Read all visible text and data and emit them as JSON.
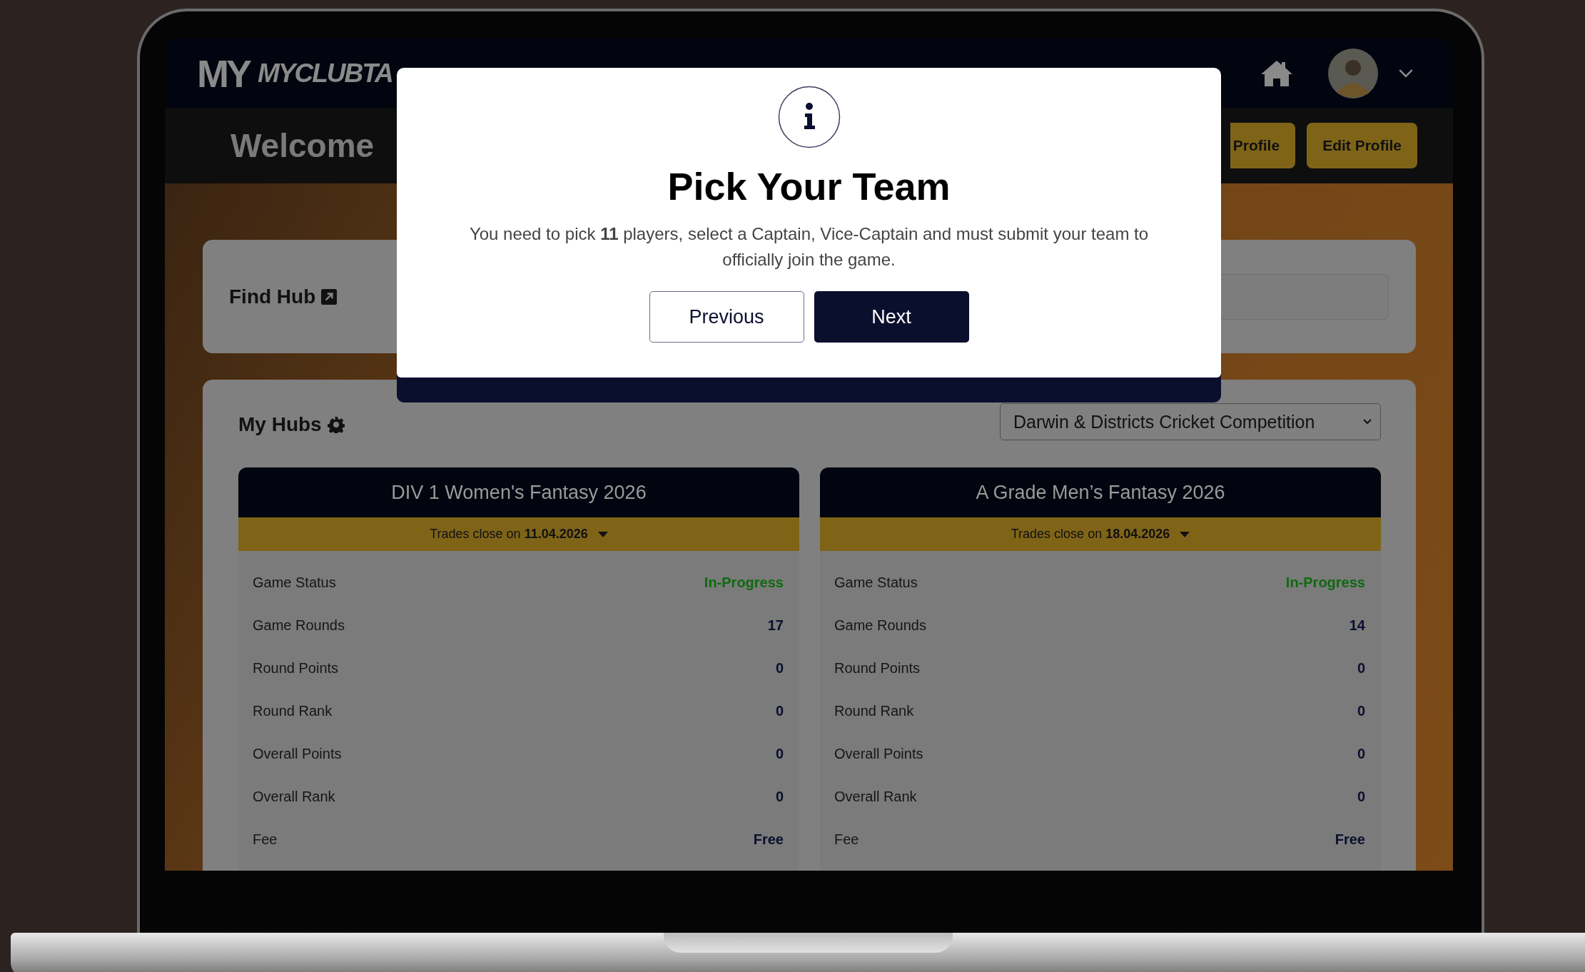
{
  "header": {
    "logo_mark": "MY",
    "logo_text": "MYCLUBTA"
  },
  "welcome": {
    "title": "Welcome",
    "buttons": [
      {
        "label": "Profile"
      },
      {
        "label": "Edit Profile"
      }
    ]
  },
  "find_hub": {
    "title": "Find Hub"
  },
  "my_hubs": {
    "title": "My Hubs",
    "competition_select": {
      "value": "Darwin & Districts Cricket Competition"
    },
    "hubs": [
      {
        "title": "DIV 1 Women's Fantasy 2026",
        "trades_close": "Trades close on **11.04.2026**",
        "stats": [
          {
            "label": "Game Status",
            "value": "In-Progress",
            "kind": "status"
          },
          {
            "label": "Game Rounds",
            "value": "17",
            "kind": "plain"
          },
          {
            "label": "Round Points",
            "value": "0",
            "kind": "plain"
          },
          {
            "label": "Round Rank",
            "value": "0",
            "kind": "plain"
          },
          {
            "label": "Overall Points",
            "value": "0",
            "kind": "plain"
          },
          {
            "label": "Overall Rank",
            "value": "0",
            "kind": "plain"
          },
          {
            "label": "Fee",
            "value": "Free",
            "kind": "plain"
          }
        ]
      },
      {
        "title": "A Grade Men’s Fantasy 2026",
        "trades_close": "Trades close on **18.04.2026**",
        "stats": [
          {
            "label": "Game Status",
            "value": "In-Progress",
            "kind": "status"
          },
          {
            "label": "Game Rounds",
            "value": "14",
            "kind": "plain"
          },
          {
            "label": "Round Points",
            "value": "0",
            "kind": "plain"
          },
          {
            "label": "Round Rank",
            "value": "0",
            "kind": "plain"
          },
          {
            "label": "Overall Points",
            "value": "0",
            "kind": "plain"
          },
          {
            "label": "Overall Rank",
            "value": "0",
            "kind": "plain"
          },
          {
            "label": "Fee",
            "value": "Free",
            "kind": "plain"
          }
        ]
      }
    ]
  },
  "modal": {
    "title": "Pick Your Team",
    "message": "You need to pick **11** players, select a Captain, Vice-Captain and must submit your team to officially join the game.",
    "buttons": [
      {
        "label": "Previous",
        "kind": "secondary"
      },
      {
        "label": "Next",
        "kind": "primary"
      }
    ]
  }
}
